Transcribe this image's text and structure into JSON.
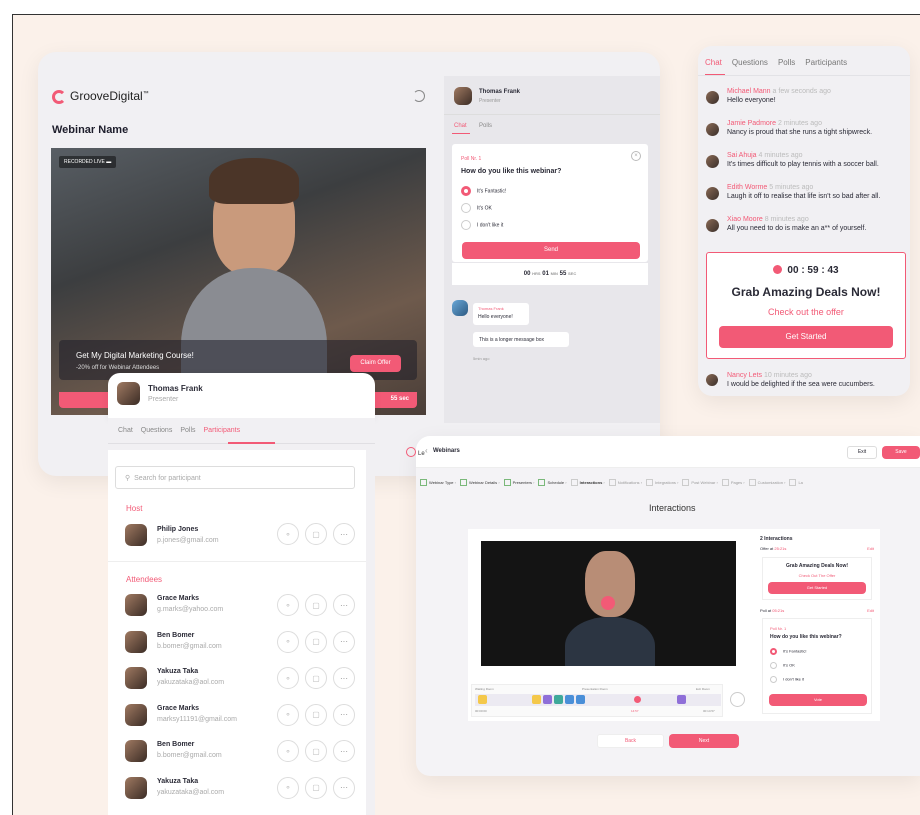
{
  "colors": {
    "accent": "#f25a76",
    "page_bg": "#fbf1ea"
  },
  "webinar": {
    "brand": "GrooveDigital",
    "trademark": "™",
    "title": "Webinar Name",
    "recorded_badge": "RECORDED LIVE",
    "offer_title": "Get My Digital Marketing Course!",
    "offer_sub": "-20% off for Webinar Attendees",
    "offer_button": "Claim Offer",
    "timer_tail": "55 sec",
    "partial_label": "Le"
  },
  "presenter_panel": {
    "name": "Thomas Frank",
    "role": "Presenter",
    "tabs": [
      "Chat",
      "Polls"
    ],
    "poll_no": "Poll Nr. 1",
    "question": "How do you like this webinar?",
    "options": [
      "It's Fantastic!",
      "It's OK",
      "I don't like it"
    ],
    "send": "Send",
    "timer": {
      "h": "00",
      "h_unit": "HRS",
      "m": "01",
      "m_unit": "MIN",
      "s": "55",
      "s_unit": "SEC"
    },
    "chat_name": "Thomas Frank",
    "chat_msg1": "Hello everyone!",
    "chat_msg2": "This is a longer message box",
    "chat_time": "5min ago"
  },
  "chat_card": {
    "tabs": [
      "Chat",
      "Questions",
      "Polls",
      "Participants"
    ],
    "messages": [
      {
        "name": "Michael Mann",
        "time": "a few seconds ago",
        "text": "Hello everyone!"
      },
      {
        "name": "Jamie Padmore",
        "time": "2 minutes ago",
        "text": "Nancy is proud that she runs a tight shipwreck."
      },
      {
        "name": "Sai Ahuja",
        "time": "4 minutes ago",
        "text": "It's times difficult to play tennis with a soccer ball."
      },
      {
        "name": "Edith Worme",
        "time": "5 minutes ago",
        "text": "Laugh it off to realise that life isn't so bad after all."
      },
      {
        "name": "Xiao Moore",
        "time": "8 minutes ago",
        "text": "All you need to do is make an a** of yourself."
      }
    ],
    "deal_timer": "00 : 59 : 43",
    "deal_title": "Grab Amazing Deals Now!",
    "deal_link": "Check out the offer",
    "deal_button": "Get Started",
    "last": {
      "name": "Nancy Lets",
      "time": "10 minutes ago",
      "text": "I would be delighted if the sea were cucumbers."
    }
  },
  "participants": {
    "presenter_name": "Thomas Frank",
    "presenter_role": "Presenter",
    "tabs": [
      "Chat",
      "Questions",
      "Polls",
      "Participants"
    ],
    "search_placeholder": "Search for participant",
    "host_label": "Host",
    "host": {
      "name": "Philip Jones",
      "email": "p.jones@gmail.com"
    },
    "attendees_label": "Attendees",
    "attendees": [
      {
        "name": "Grace Marks",
        "email": "g.marks@yahoo.com"
      },
      {
        "name": "Ben Bomer",
        "email": "b.bomer@gmail.com"
      },
      {
        "name": "Yakuza Taka",
        "email": "yakuzataka@aol.com"
      },
      {
        "name": "Grace Marks",
        "email": "marksy11191@gmail.com"
      },
      {
        "name": "Ben Bomer",
        "email": "b.bomer@gmail.com"
      },
      {
        "name": "Yakuza Taka",
        "email": "yakuzataka@aol.com"
      }
    ]
  },
  "editor": {
    "back_link": "Webinars",
    "exit": "Exit",
    "save": "Save",
    "steps": [
      "Webinar Type",
      "Webinar Details",
      "Presenters",
      "Schedule",
      "Interactions",
      "Notifications",
      "Integrations",
      "Post Webinar",
      "Pages",
      "Customization",
      "La"
    ],
    "heading": "Interactions",
    "count": "2 Interactions",
    "offer_at": "Offer at",
    "offer_time": "25:21s",
    "edit": "Edit",
    "deal_title": "Grab Amazing Deals Now!",
    "deal_link": "Check Out The Offer",
    "deal_button": "Get Started",
    "poll_at": "Poll at",
    "poll_time": "05:21s",
    "poll_no": "Poll Nr. 1",
    "poll_q": "How do you like this webinar?",
    "poll_opts": [
      "It's Fantastic!",
      "It's OK",
      "I don't like it"
    ],
    "poll_button": "Vote",
    "tl_waiting": "Waiting Room",
    "tl_presentation": "Presentation Room",
    "tl_exit": "Exit Room",
    "tl_start": "00:00:00",
    "tl_mid": "14:57",
    "tl_end": "00:14:57",
    "back": "Back",
    "next": "Next"
  }
}
